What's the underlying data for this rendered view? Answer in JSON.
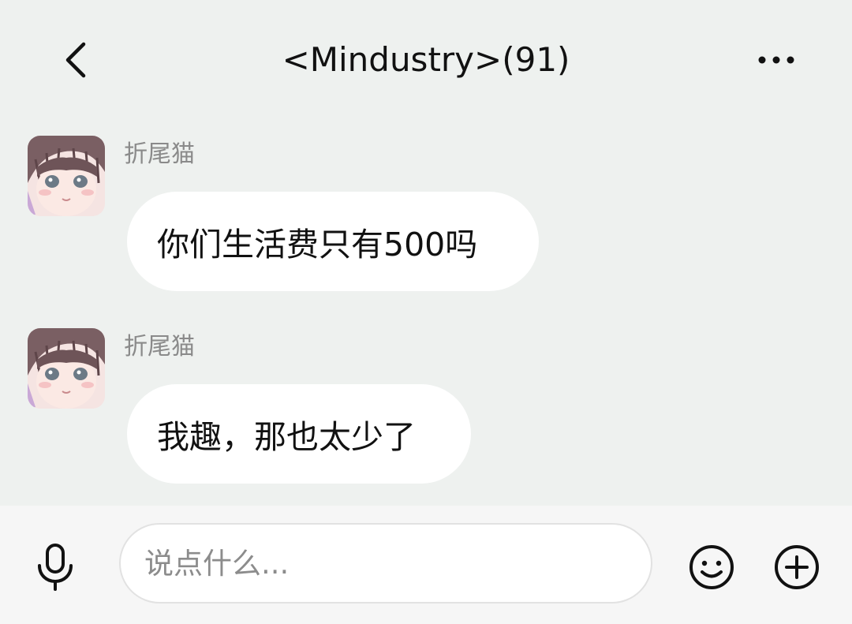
{
  "header": {
    "title": "<Mindustry>(91)",
    "back_icon": "chevron-left-icon",
    "more_icon": "more-horizontal-icon"
  },
  "messages": [
    {
      "sender": "折尾猫",
      "text": "你们生活费只有500吗",
      "avatar_icon": "anime-girl-avatar"
    },
    {
      "sender": "折尾猫",
      "text": "我趣，那也太少了",
      "avatar_icon": "anime-girl-avatar"
    }
  ],
  "input_bar": {
    "placeholder": "说点什么...",
    "value": "",
    "mic_icon": "microphone-icon",
    "emoji_icon": "smiley-icon",
    "plus_icon": "plus-circle-icon"
  },
  "colors": {
    "background": "#eef1ef",
    "bubble": "#ffffff",
    "input_bar": "#f6f6f6",
    "sender_text": "#8a8a8a",
    "text": "#111111"
  }
}
